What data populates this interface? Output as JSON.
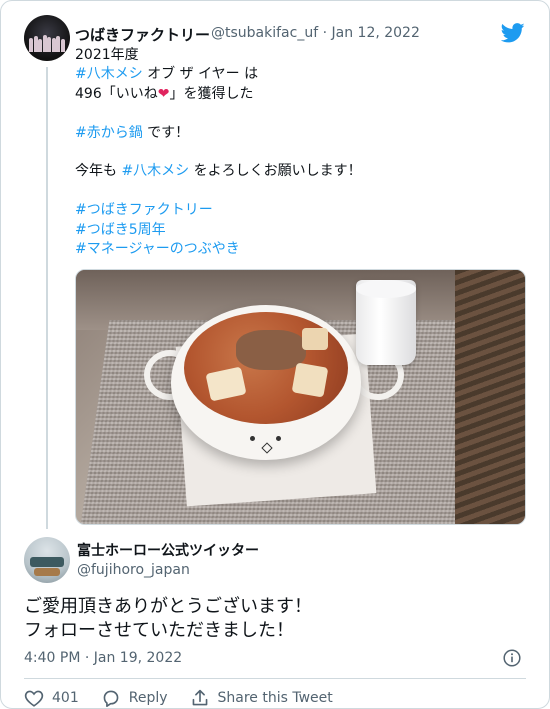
{
  "tweet": {
    "author_name": "つばきファクトリー",
    "handle": "@tsubakifac_uf",
    "separator": " · ",
    "date": "Jan 12, 2022",
    "lines": [
      {
        "plain": "2021年度"
      },
      {
        "tag": "#八木メシ",
        "after": " オブ ザ イヤー は"
      },
      {
        "before": "496「いいね",
        "emoji": "❤",
        "after": "」を獲得した"
      },
      {
        "plain": ""
      },
      {
        "tag": "#赤から鍋",
        "after": " です！"
      },
      {
        "plain": ""
      },
      {
        "before": "今年も ",
        "tag": "#八木メシ",
        "after": " をよろしくお願いします！"
      },
      {
        "plain": ""
      },
      {
        "tag": "#つばきファクトリー"
      },
      {
        "tag": "#つばき5周年"
      },
      {
        "tag": "#マネージャーのつぶやき"
      }
    ]
  },
  "reply": {
    "author_name": "富士ホーロー公式ツイッター",
    "handle": "@fujihoro_japan",
    "text_lines": [
      "ご愛用頂きありがとうございます！",
      "フォローさせていただきました！"
    ],
    "timestamp": "4:40 PM · Jan 19, 2022"
  },
  "actions": {
    "like_count": "401",
    "reply_label": "Reply",
    "share_label": "Share this Tweet"
  },
  "colors": {
    "hashtag": "#1d9bf0",
    "heart": "#e0245e",
    "muted": "#536471",
    "twitter_bird": "#1d9bf0"
  },
  "icons": [
    "twitter-bird-icon",
    "heart-icon",
    "reply-icon",
    "share-icon",
    "info-icon"
  ]
}
